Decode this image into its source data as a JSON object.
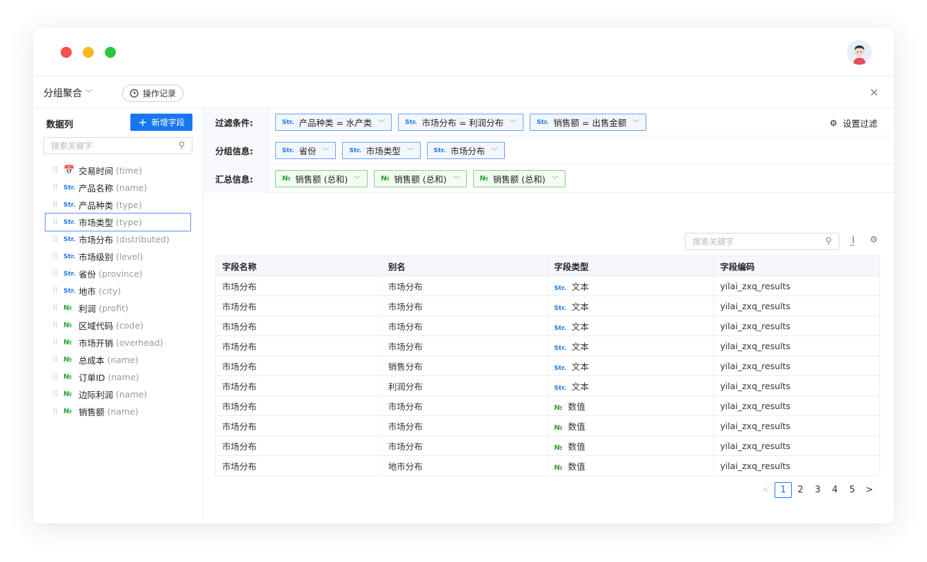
{
  "toolbar": {
    "mode": "分组聚合",
    "history": "操作记录"
  },
  "leftpanel": {
    "title": "数据列",
    "add_button": "新增字段",
    "search_placeholder": "搜索关键字",
    "fields": [
      {
        "type": "cal",
        "name": "交易时间",
        "key": "(time)"
      },
      {
        "type": "str",
        "name": "产品名称",
        "key": "(name)"
      },
      {
        "type": "str",
        "name": "产品种类",
        "key": "(type)"
      },
      {
        "type": "str",
        "name": "市场类型",
        "key": "(type)"
      },
      {
        "type": "str",
        "name": "市场分布",
        "key": "(distributed)"
      },
      {
        "type": "str",
        "name": "市场级别",
        "key": "(level)"
      },
      {
        "type": "str",
        "name": "省份",
        "key": "(province)"
      },
      {
        "type": "str",
        "name": "地市",
        "key": "(city)"
      },
      {
        "type": "num",
        "name": "利润",
        "key": "(profit)"
      },
      {
        "type": "num",
        "name": "区域代码",
        "key": "(code)"
      },
      {
        "type": "num",
        "name": "市场开销",
        "key": "(overhead)"
      },
      {
        "type": "num",
        "name": "总成本",
        "key": "(name)"
      },
      {
        "type": "num",
        "name": "订单ID",
        "key": "(name)"
      },
      {
        "type": "num",
        "name": "边际利润",
        "key": "(name)"
      },
      {
        "type": "num",
        "name": "销售额",
        "key": "(name)"
      }
    ],
    "type_tags": {
      "str": "Str.",
      "num": "№",
      "cal": "📅"
    }
  },
  "conditions": {
    "filter_label": "过滤条件:",
    "filters": [
      "产品种类 = 水产类",
      "市场分布 = 利润分布",
      "销售额 = 出售金额"
    ],
    "filter_settings": "设置过滤",
    "group_label": "分组信息:",
    "groups": [
      "省份",
      "市场类型",
      "市场分布"
    ],
    "summary_label": "汇总信息:",
    "summaries": [
      "销售额 (总和)",
      "销售额 (总和)",
      "销售额 (总和)"
    ]
  },
  "table": {
    "search_placeholder": "搜索关键字",
    "columns": [
      "字段名称",
      "别名",
      "字段类型",
      "字段编码"
    ],
    "rows": [
      {
        "name": "市场分布",
        "alias": "市场分布",
        "alias_muted": true,
        "type": "str",
        "type_label": "文本",
        "code": "yilai_zxq_results"
      },
      {
        "name": "市场分布",
        "alias": "市场分布",
        "alias_muted": true,
        "type": "str",
        "type_label": "文本",
        "code": "yilai_zxq_results"
      },
      {
        "name": "市场分布",
        "alias": "市场分布",
        "alias_muted": true,
        "type": "str",
        "type_label": "文本",
        "code": "yilai_zxq_results"
      },
      {
        "name": "市场分布",
        "alias": "市场分布",
        "alias_muted": true,
        "type": "str",
        "type_label": "文本",
        "code": "yilai_zxq_results"
      },
      {
        "name": "市场分布",
        "alias": "销售分布",
        "alias_muted": false,
        "type": "str",
        "type_label": "文本",
        "code": "yilai_zxq_results"
      },
      {
        "name": "市场分布",
        "alias": "利润分布",
        "alias_muted": false,
        "type": "str",
        "type_label": "文本",
        "code": "yilai_zxq_results"
      },
      {
        "name": "市场分布",
        "alias": "市场分布",
        "alias_muted": true,
        "type": "num",
        "type_label": "数值",
        "code": "yilai_zxq_results"
      },
      {
        "name": "市场分布",
        "alias": "市场分布",
        "alias_muted": true,
        "type": "num",
        "type_label": "数值",
        "code": "yilai_zxq_results"
      },
      {
        "name": "市场分布",
        "alias": "市场分布",
        "alias_muted": true,
        "type": "num",
        "type_label": "数值",
        "code": "yilai_zxq_results"
      },
      {
        "name": "市场分布",
        "alias": "地市分布",
        "alias_muted": false,
        "type": "num",
        "type_label": "数值",
        "code": "yilai_zxq_results"
      }
    ]
  },
  "pagination": {
    "pages": [
      "1",
      "2",
      "3",
      "4",
      "5"
    ],
    "current": "1",
    "prev": "<",
    "next": ">"
  },
  "colors": {
    "accent": "#1877f2",
    "str_tag": "#1877f2",
    "num_tag": "#27a32b"
  }
}
